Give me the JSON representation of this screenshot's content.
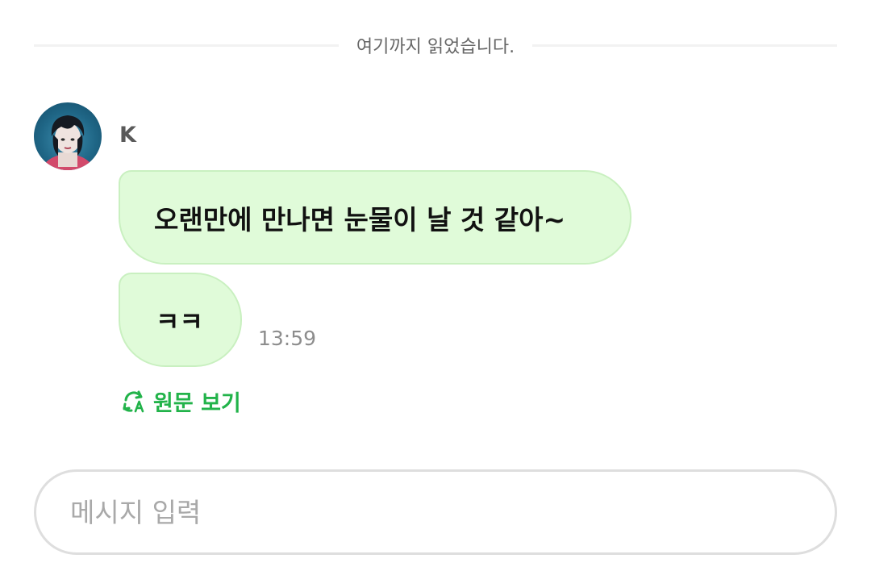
{
  "divider": {
    "read_label": "여기까지 읽었습니다."
  },
  "sender": {
    "name": "K",
    "avatar_icon": "avatar-photo"
  },
  "messages": [
    {
      "text": "오랜만에 만나면 눈물이 날 것 같아~"
    },
    {
      "text": "ㅋㅋ",
      "time": "13:59"
    }
  ],
  "translate": {
    "label": "원문 보기",
    "icon": "translate-refresh-icon",
    "color": "#22b34a"
  },
  "composer": {
    "placeholder": "메시지 입력"
  },
  "colors": {
    "bubble_bg": "#e0fbd9",
    "bubble_border": "#c9f0c0",
    "accent_green": "#22b34a"
  }
}
